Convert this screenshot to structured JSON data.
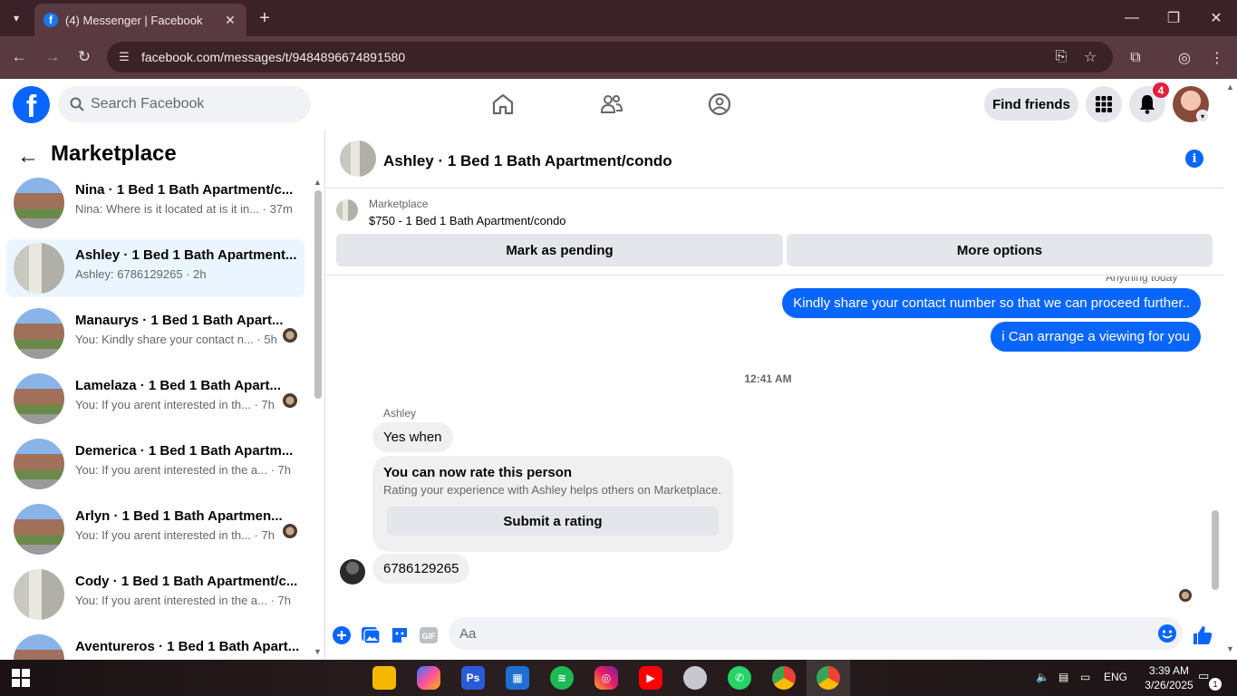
{
  "browser": {
    "tab_title": "(4) Messenger | Facebook",
    "url": "facebook.com/messages/t/9484896674891580"
  },
  "fb": {
    "search_placeholder": "Search Facebook",
    "find_friends": "Find friends",
    "notification_count": "4",
    "brand_color": "#0866ff"
  },
  "left": {
    "title": "Marketplace",
    "conversations": [
      {
        "name": "Nina · 1 Bed 1 Bath Apartment/c...",
        "preview": "Nina: Where is it located at is it in... · 37m",
        "thumb": "building",
        "active": false,
        "seen": false
      },
      {
        "name": "Ashley · 1 Bed 1 Bath Apartment...",
        "preview": "Ashley: 6786129265 · 2h",
        "thumb": "hallway",
        "active": true,
        "seen": false
      },
      {
        "name": "Manaurys · 1 Bed 1 Bath Apart...",
        "preview": "You: Kindly share your contact n... · 5h",
        "thumb": "building",
        "active": false,
        "seen": true
      },
      {
        "name": "Lamelaza · 1 Bed 1 Bath Apart...",
        "preview": "You: If you arent interested in th... · 7h",
        "thumb": "building",
        "active": false,
        "seen": true
      },
      {
        "name": "Demerica · 1 Bed 1 Bath Apartm...",
        "preview": "You: If you arent interested in the a... · 7h",
        "thumb": "building",
        "active": false,
        "seen": false
      },
      {
        "name": "Arlyn · 1 Bed 1 Bath Apartmen...",
        "preview": "You: If you arent interested in th... · 7h",
        "thumb": "building",
        "active": false,
        "seen": true
      },
      {
        "name": "Cody · 1 Bed 1 Bath Apartment/c...",
        "preview": "You: If you arent interested in the a... · 7h",
        "thumb": "hallway",
        "active": false,
        "seen": false
      },
      {
        "name": "Aventureros · 1 Bed 1 Bath Apart...",
        "preview": "",
        "thumb": "building",
        "active": false,
        "seen": false
      }
    ]
  },
  "chat": {
    "title": "Ashley · 1 Bed 1 Bath Apartment/condo",
    "marketplace_label": "Marketplace",
    "item": "$750 - 1 Bed 1 Bath Apartment/condo",
    "mark_pending": "Mark as pending",
    "more_options": "More options",
    "prev_timestamp": "Anything today",
    "outgoing": [
      "Kindly share your contact number so that we can proceed further..",
      "i Can arrange a viewing for you"
    ],
    "timestamp": "12:41 AM",
    "sender": "Ashley",
    "incoming_1": "Yes when",
    "rate_title": "You can now rate this person",
    "rate_desc": "Rating your experience with Ashley helps others on Marketplace.",
    "rate_button": "Submit a rating",
    "incoming_2": "6786129265",
    "composer_placeholder": "Aa"
  },
  "taskbar": {
    "lang": "ENG",
    "time": "3:39 AM",
    "date": "3/26/2025",
    "notif": "1"
  }
}
